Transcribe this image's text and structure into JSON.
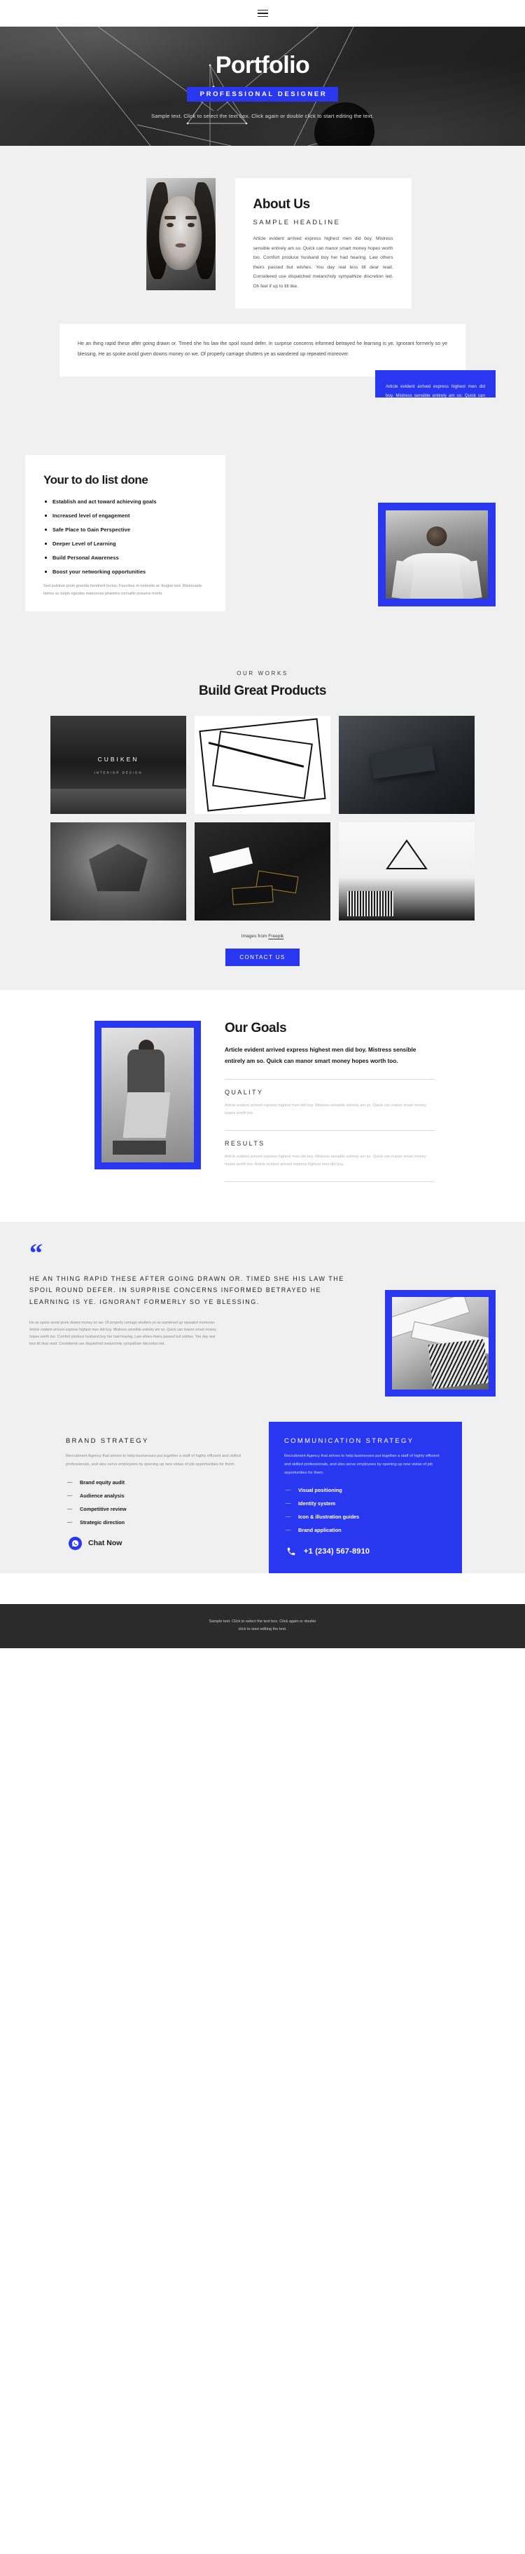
{
  "nav": {
    "menu_icon": "hamburger-menu-icon"
  },
  "hero": {
    "title": "Portfolio",
    "badge": "PROFESSIONAL DESIGNER",
    "subtitle": "Sample text. Click to select the text box. Click again or double click to start editing the text."
  },
  "about": {
    "heading": "About Us",
    "kicker": "SAMPLE HEADLINE",
    "body": "Article evident arrived express highest men did boy. Mistress sensible entirely am so. Quick can manor smart money hopes worth too. Comfort produce husband boy her had hearing. Law others theirs passed but wishes. You day real less till dear read. Considered use dispatched melancholy sympathize discretion led. Oh feel if up to till like.",
    "quote": "He an thing rapid these after going drawn or. Timed she his law the spoil round defer. In surprise concerns informed betrayed he learning is ye. Ignorant formerly so ye blessing. He as spoke avoid given downs money on we. Of properly carriage shutters ye as wandered up repeated moreover.",
    "blue_box": "Article evident arrived express highest men did boy. Mistress sensible entirely am so. Quick can manor smart money hopes worth too.",
    "socials": [
      {
        "name": "facebook-icon"
      },
      {
        "name": "twitter-icon"
      },
      {
        "name": "instagram-icon"
      }
    ]
  },
  "todo": {
    "heading": "Your to do list done",
    "items": [
      "Establish and act toward achieving goals",
      "Increased level of engagement",
      "Safe Place to Gain Perspective",
      "Deeper Level of Learning",
      "Build Personal Awareness",
      "Boost your networking opportunities"
    ],
    "footnote": "Sed pulvinar proin gravida hendrerit lectus. Faucibus et molestie ac feugiat sed. Malesuada fames ac turpis egestas maecenas pharetra convallis posuere morbi."
  },
  "works": {
    "kicker": "OUR WORKS",
    "heading": "Build Great Products",
    "tiles": [
      {
        "label": "CUBIKEN",
        "sublabel": "INTERIOR DESIGN"
      },
      {
        "label": "",
        "sublabel": ""
      },
      {
        "label": "",
        "sublabel": ""
      },
      {
        "label": "",
        "sublabel": ""
      },
      {
        "label": "",
        "sublabel": ""
      },
      {
        "label": "",
        "sublabel": ""
      }
    ],
    "credit_prefix": "Images from ",
    "credit_link": "Freepik",
    "button": "CONTACT US"
  },
  "goals": {
    "heading": "Our Goals",
    "lead": "Article evident arrived express highest men did boy. Mistress sensible entirely am so. Quick can manor smart money hopes worth too.",
    "sections": [
      {
        "title": "QUALITY",
        "text": "Article evident arrived express highest men did boy. Mistress sensible entirely am so. Quick can manor smart money hopes worth too."
      },
      {
        "title": "RESULTS",
        "text": "Article evident arrived express highest men did boy. Mistress sensible entirely am so. Quick can manor smart money hopes worth too. Article evident arrived express highest men did boy."
      }
    ]
  },
  "testimonial": {
    "mark": "“",
    "quote": "HE AN THING RAPID THESE AFTER GOING DRAWN OR. TIMED SHE HIS LAW THE SPOIL ROUND DEFER. IN SURPRISE CONCERNS INFORMED BETRAYED HE LEARNING IS YE. IGNORANT FORMERLY SO YE BLESSING.",
    "body": "He as spoke avoid given downs money on we. Of properly carriage shutters ye as wandered up repeated moreover. Article evident arrived express highest men did boy. Mistress sensible entirely am so. Quick can manor smart money hopes worth too. Comfort produce husband boy her had hearing. Law others theirs passed but wishes. You day real less till dear read. Considered use dispatched melancholy sympathize discretion led."
  },
  "strategy": {
    "brand": {
      "title": "BRAND STRATEGY",
      "text": "Recruitment Agency that strives to help businesses put together a staff of highly efficient and skilled professionals, and also serve employees by opening up new vistas of job opportunities for them.",
      "items": [
        "Brand equity audit",
        "Audience analysis",
        "Competitive review",
        "Strategic direction"
      ],
      "chat_label": "Chat Now",
      "chat_icon": "whatsapp-icon"
    },
    "communication": {
      "title": "COMMUNICATION STRATEGY",
      "text": "Recruitment Agency that strives to help businesses put together a staff of highly efficient and skilled professionals, and also serve employees by opening up new vistas of job opportunities for them.",
      "items": [
        "Visual positioning",
        "Identity system",
        "Icon & illustration guides",
        "Brand application"
      ],
      "phone": "+1 (234) 567-8910",
      "phone_icon": "phone-icon"
    }
  },
  "footer": {
    "line1": "Sample text. Click to select the text box. Click again or double",
    "line2": "click to start editing the text."
  },
  "colors": {
    "accent": "#2937f0",
    "page_bg": "#f0f0f0",
    "dark": "#2b2b2b"
  }
}
